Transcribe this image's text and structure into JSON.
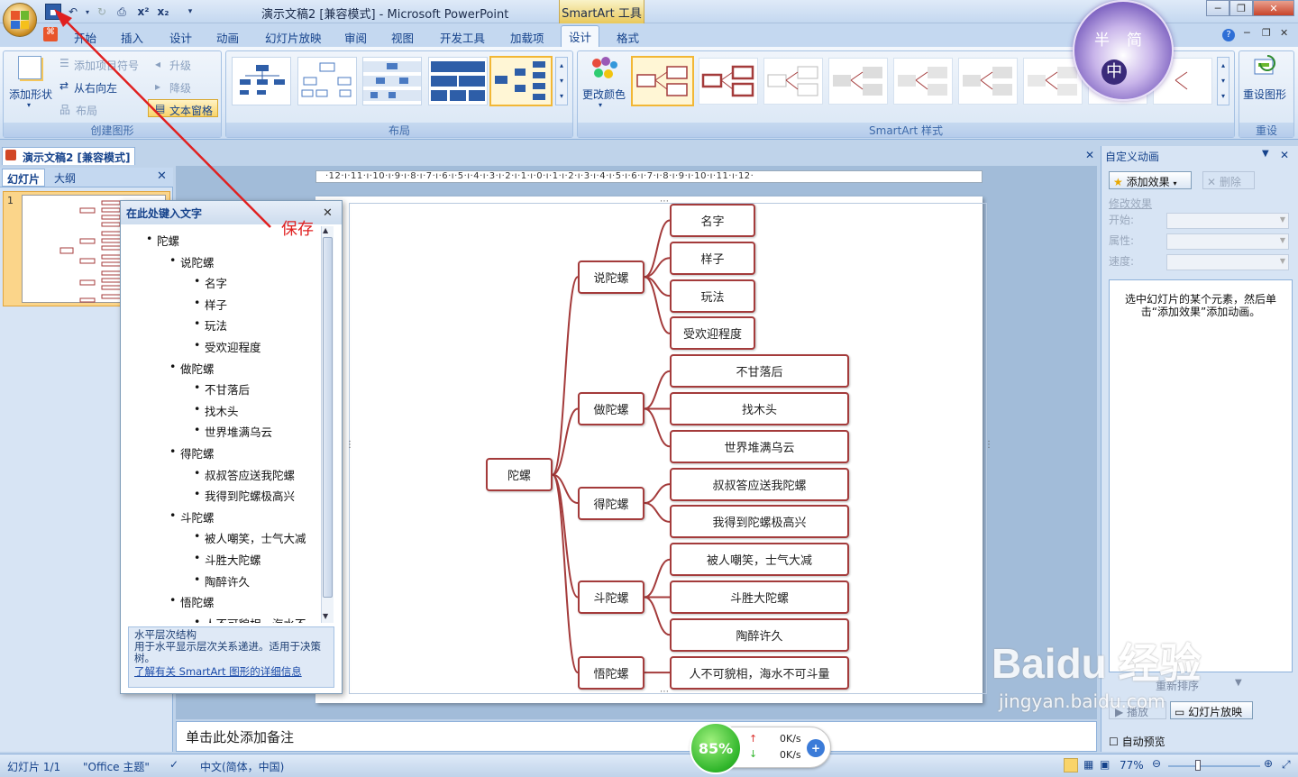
{
  "window": {
    "title": "演示文稿2 [兼容模式] - Microsoft PowerPoint",
    "contextual_tab": "SmartArt 工具"
  },
  "ribbon": {
    "tabs": [
      "开始",
      "插入",
      "设计",
      "动画",
      "幻灯片放映",
      "审阅",
      "视图",
      "开发工具",
      "加载项",
      "设计",
      "格式"
    ],
    "create_group": {
      "add_shape": "添加形状",
      "add_bullet": "添加项目符号",
      "right_to_left": "从右向左",
      "layout": "布局",
      "promote": "升级",
      "demote": "降级",
      "text_pane": "文本窗格",
      "label": "创建图形"
    },
    "layout_group_label": "布局",
    "styles": {
      "change_colors": "更改颜色",
      "label": "SmartArt 样式"
    },
    "reset": {
      "button": "重设图形",
      "label": "重设"
    }
  },
  "document_tab": "演示文稿2 [兼容模式]",
  "left_pane": {
    "tab_slides": "幻灯片",
    "tab_outline": "大纲",
    "slide_number": "1"
  },
  "ruler_text": "·12·ı·11·ı·10·ı·9·ı·8·ı·7·ı·6·ı·5·ı·4·ı·3·ı·2·ı·1·ı·0·ı·1·ı·2·ı·3·ı·4·ı·5·ı·6·ı·7·ı·8·ı·9·ı·10·ı·11·ı·12·",
  "text_pane": {
    "title": "在此处键入文字",
    "items": [
      {
        "text": "陀螺",
        "level": 0
      },
      {
        "text": "说陀螺",
        "level": 1
      },
      {
        "text": "名字",
        "level": 2
      },
      {
        "text": "样子",
        "level": 2
      },
      {
        "text": "玩法",
        "level": 2
      },
      {
        "text": "受欢迎程度",
        "level": 2
      },
      {
        "text": "做陀螺",
        "level": 1
      },
      {
        "text": "不甘落后",
        "level": 2
      },
      {
        "text": "找木头",
        "level": 2
      },
      {
        "text": "世界堆满乌云",
        "level": 2
      },
      {
        "text": "得陀螺",
        "level": 1
      },
      {
        "text": "叔叔答应送我陀螺",
        "level": 2
      },
      {
        "text": "我得到陀螺极高兴",
        "level": 2
      },
      {
        "text": "斗陀螺",
        "level": 1
      },
      {
        "text": "被人嘲笑，士气大减",
        "level": 2
      },
      {
        "text": "斗胜大陀螺",
        "level": 2
      },
      {
        "text": "陶醉许久",
        "level": 2
      },
      {
        "text": "悟陀螺",
        "level": 1
      },
      {
        "text": "人不可貌相，海水不",
        "level": 2
      }
    ],
    "desc_title": "水平层次结构",
    "desc_body": "用于水平显示层次关系递进。适用于决策树。",
    "desc_link": "了解有关 SmartArt 图形的详细信息"
  },
  "diagram": {
    "root": "陀螺",
    "branches": [
      {
        "label": "说陀螺",
        "children": [
          "名字",
          "样子",
          "玩法",
          "受欢迎程度"
        ]
      },
      {
        "label": "做陀螺",
        "children": [
          "不甘落后",
          "找木头",
          "世界堆满乌云"
        ]
      },
      {
        "label": "得陀螺",
        "children": [
          "叔叔答应送我陀螺",
          "我得到陀螺极高兴"
        ]
      },
      {
        "label": "斗陀螺",
        "children": [
          "被人嘲笑，士气大减",
          "斗胜大陀螺",
          "陶醉许久"
        ]
      },
      {
        "label": "悟陀螺",
        "children": [
          "人不可貌相，海水不可斗量"
        ]
      }
    ]
  },
  "annotation": "保存",
  "right_pane": {
    "title": "自定义动画",
    "add_effect": "添加效果",
    "delete": "删除",
    "modify": "修改效果",
    "start": "开始:",
    "property": "属性:",
    "speed": "速度:",
    "hint": "选中幻灯片的某个元素，然后单击“添加效果”添加动画。",
    "reorder": "重新排序",
    "play": "播放",
    "slideshow": "幻灯片放映",
    "autopreview": "自动预览"
  },
  "notes_placeholder": "单击此处添加备注",
  "status": {
    "slide": "幻灯片 1/1",
    "theme": "\"Office 主题\"",
    "language": "中文(简体，中国)",
    "zoom": "77%"
  },
  "speed_widget": {
    "percent": "85%",
    "up": "0K/s",
    "down": "0K/s"
  },
  "avatar_chars": [
    "半",
    "简",
    "中"
  ],
  "watermark": {
    "main": "Baidu 经验",
    "sub": "jingyan.baidu.com"
  },
  "colors": {
    "node_border": "#a43b3b",
    "connector": "#a43b3b",
    "annotation": "#e02020"
  }
}
